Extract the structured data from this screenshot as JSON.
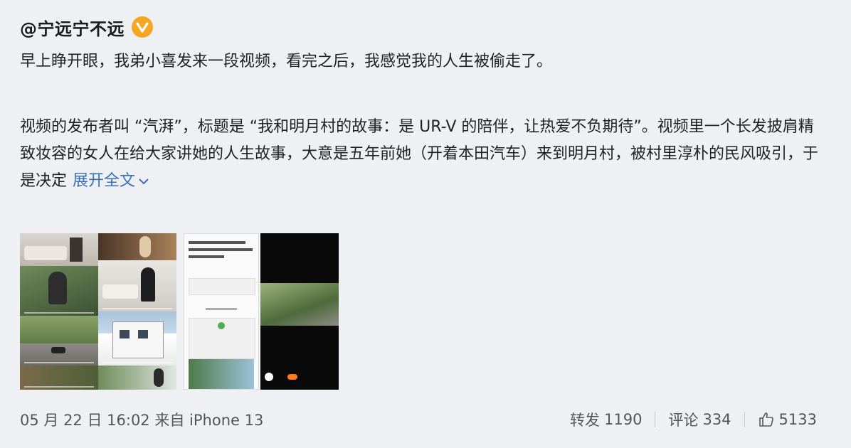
{
  "post": {
    "author": "@宁远宁不远",
    "paragraph1": "早上睁开眼，我弟小喜发来一段视频，看完之后，我感觉我的人生被偷走了。",
    "paragraph2": "视频的发布者叫 “汽湃”，标题是 “我和明月村的故事：是 UR-V 的陪伴，让热爱不负期待”。视频里一个长发披肩精致妆容的女人在给大家讲她的人生故事，大意是五年前她（开着本田汽车）来到明月村，被村里淳朴的民风吸引，于是决定",
    "expand_label": "展开全文",
    "icons": {
      "verified": "verified-badge-icon",
      "expand": "chevron-down-icon",
      "like": "thumbs-up-icon"
    },
    "colors": {
      "badge": "#f5a623",
      "link": "#3a6fb7"
    }
  },
  "footer": {
    "date": "05 月 22 日 16:02",
    "source": "来自 iPhone 13",
    "repost_label": "转发",
    "repost_count": "1190",
    "comment_label": "评论",
    "comment_count": "334",
    "like_count": "5133"
  }
}
